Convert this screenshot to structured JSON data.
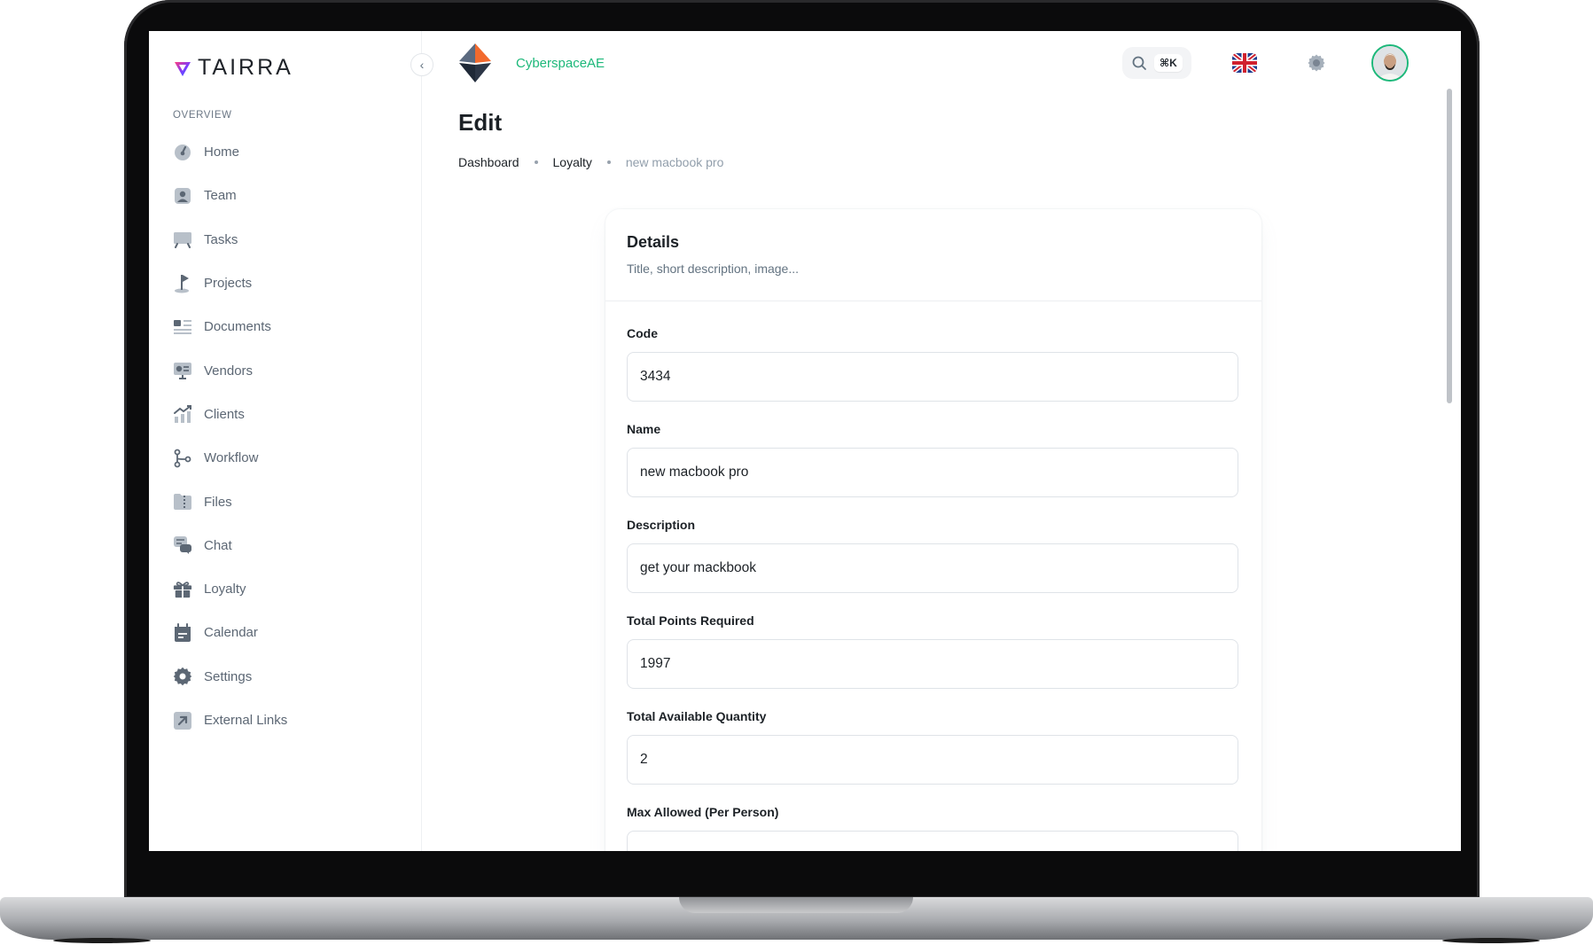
{
  "app": {
    "brand": "TAIRRA",
    "org_name": "CyberspaceAE",
    "collapse_icon": "chevron-left-icon"
  },
  "sidebar": {
    "section_label": "OVERVIEW",
    "items": [
      {
        "label": "Home",
        "icon": "dashboard-gauge-icon"
      },
      {
        "label": "Team",
        "icon": "user-icon"
      },
      {
        "label": "Tasks",
        "icon": "whiteboard-icon"
      },
      {
        "label": "Projects",
        "icon": "flag-icon"
      },
      {
        "label": "Documents",
        "icon": "document-list-icon"
      },
      {
        "label": "Vendors",
        "icon": "vendor-card-icon"
      },
      {
        "label": "Clients",
        "icon": "chart-growth-icon"
      },
      {
        "label": "Workflow",
        "icon": "workflow-icon"
      },
      {
        "label": "Files",
        "icon": "folder-zip-icon"
      },
      {
        "label": "Chat",
        "icon": "chat-icon"
      },
      {
        "label": "Loyalty",
        "icon": "gift-icon"
      },
      {
        "label": "Calendar",
        "icon": "calendar-icon"
      },
      {
        "label": "Settings",
        "icon": "gear-icon"
      },
      {
        "label": "External Links",
        "icon": "external-link-icon"
      }
    ]
  },
  "header": {
    "search_shortcut": "⌘K",
    "language_icon": "uk-flag-icon",
    "settings_icon": "gear-icon"
  },
  "page": {
    "title": "Edit",
    "breadcrumb": [
      "Dashboard",
      "Loyalty",
      "new macbook pro"
    ]
  },
  "card": {
    "title": "Details",
    "subtitle": "Title, short description, image...",
    "fields": [
      {
        "label": "Code",
        "value": "3434"
      },
      {
        "label": "Name",
        "value": "new macbook pro"
      },
      {
        "label": "Description",
        "value": "get your mackbook"
      },
      {
        "label": "Total Points Required",
        "value": "1997"
      },
      {
        "label": "Total Available Quantity",
        "value": "2"
      },
      {
        "label": "Max Allowed (Per Person)",
        "value": ""
      }
    ]
  },
  "colors": {
    "accent": "#1db87a",
    "text_primary": "#1c2126",
    "text_secondary": "#637381"
  }
}
